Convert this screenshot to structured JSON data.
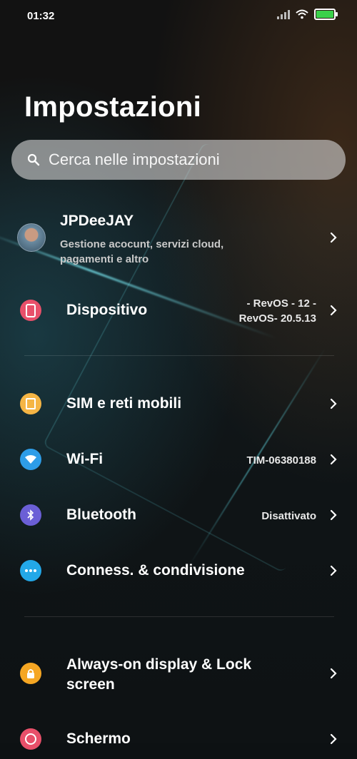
{
  "status_bar": {
    "time": "01:32",
    "battery_level": 1.0,
    "battery_color": "#3ad14a"
  },
  "page": {
    "title": "Impostazioni"
  },
  "search": {
    "placeholder": "Cerca nelle impostazioni"
  },
  "account": {
    "name": "JPDeeJAY",
    "subtitle_line1": "Gestione acocunt, servizi cloud,",
    "subtitle_line2": "pagamenti e altro"
  },
  "items": [
    {
      "id": "device",
      "label": "Dispositivo",
      "value_line1": "- RevOS - 12 -",
      "value_line2": "RevOS- 20.5.13",
      "icon": "phone-icon",
      "color": "#e8506a"
    },
    {
      "id": "sim",
      "label": "SIM e reti mobili",
      "value": "",
      "icon": "sim-icon",
      "color": "#f5b545"
    },
    {
      "id": "wifi",
      "label": "Wi-Fi",
      "value": "TIM-06380188",
      "icon": "wifi-icon",
      "color": "#2e9de8"
    },
    {
      "id": "bluetooth",
      "label": "Bluetooth",
      "value": "Disattivato",
      "icon": "bluetooth-icon",
      "color": "#6b5fd6"
    },
    {
      "id": "connection",
      "label": "Conness. & condivisione",
      "value": "",
      "icon": "connection-icon",
      "color": "#23a8e8"
    },
    {
      "id": "aod",
      "label_line1": "Always-on display & Lock",
      "label_line2": "screen",
      "icon": "lock-icon",
      "color": "#f5a623"
    },
    {
      "id": "display",
      "label": "Schermo",
      "icon": "display-icon",
      "color": "#e8506a"
    }
  ]
}
